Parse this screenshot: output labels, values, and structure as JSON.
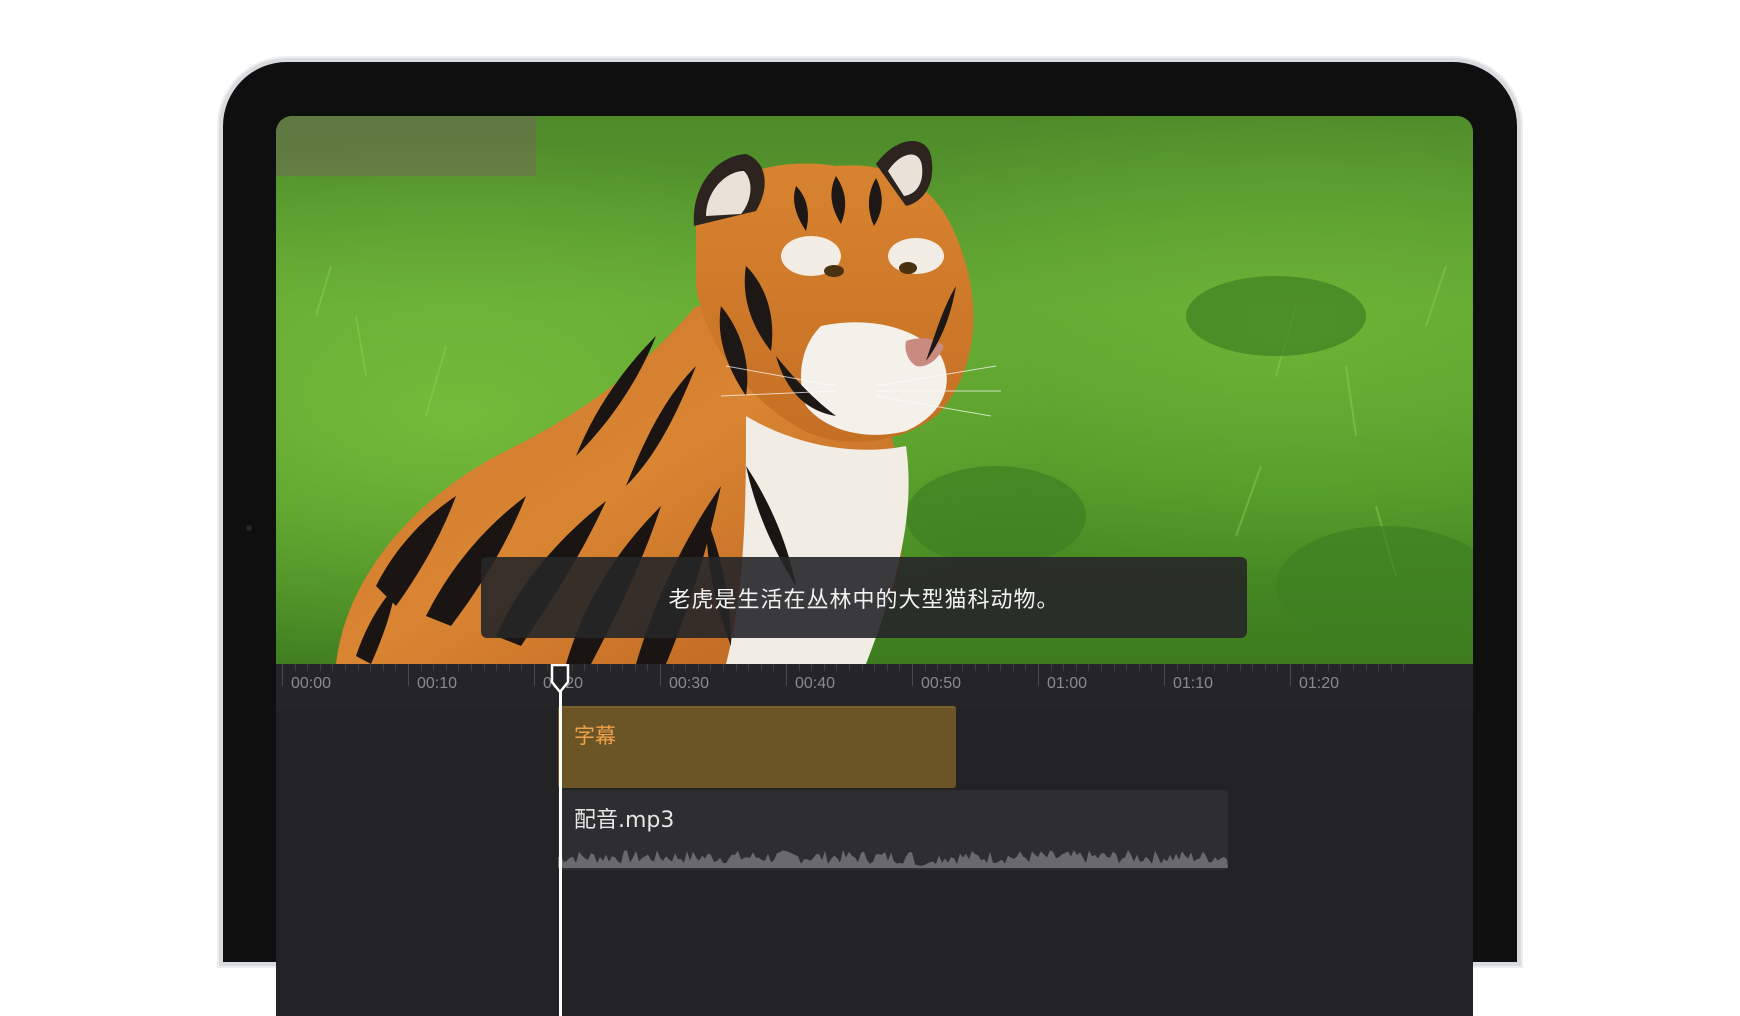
{
  "video": {
    "subtitle": "老虎是生活在丛林中的大型猫科动物。"
  },
  "timeline": {
    "ruler_labels": [
      "00:00",
      "00:10",
      "00:20",
      "00:30",
      "00:40",
      "00:50",
      "01:00",
      "01:10",
      "01:20"
    ],
    "tracks": {
      "subtitle_label": "字幕",
      "audio_label": "配音.mp3"
    }
  },
  "colors": {
    "subtitle_track": "#6b5426",
    "subtitle_track_text": "#f0a24a",
    "audio_track": "#2e2e31",
    "playhead": "#ffffff",
    "timeline_bg": "#232325"
  }
}
